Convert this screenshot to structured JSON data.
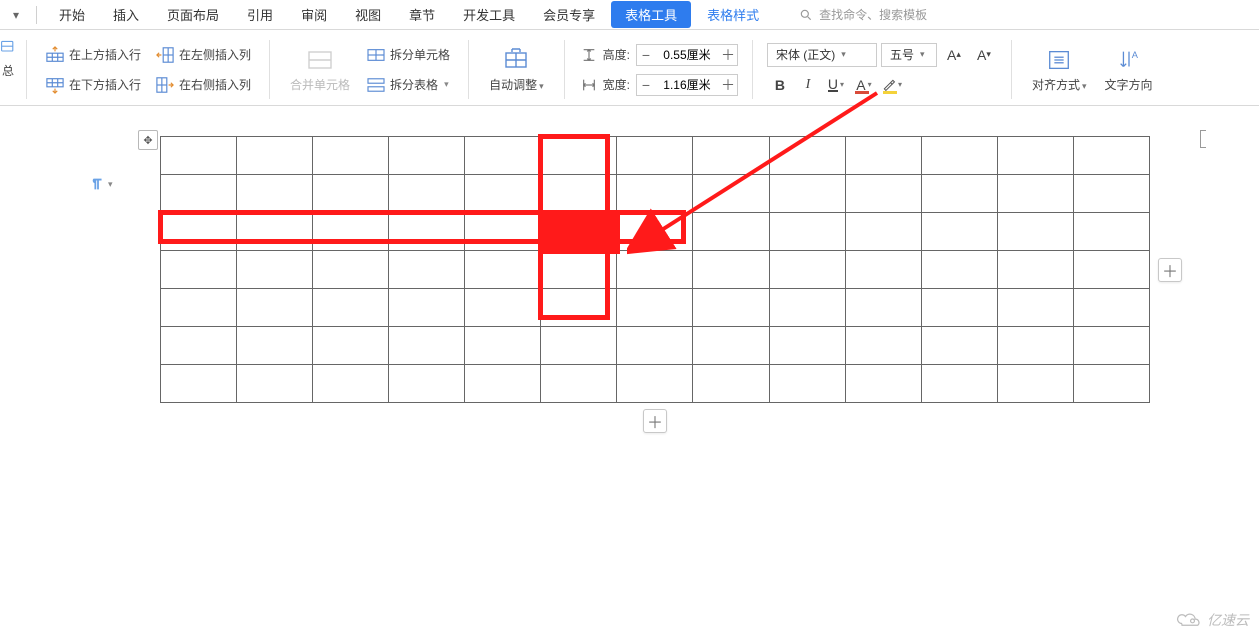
{
  "menu": {
    "items": [
      "开始",
      "插入",
      "页面布局",
      "引用",
      "审阅",
      "视图",
      "章节",
      "开发工具",
      "会员专享"
    ],
    "active_tool": "表格工具",
    "style_tab": "表格样式",
    "search_placeholder": "查找命令、搜索模板"
  },
  "ribbon": {
    "left_trunc_top": "",
    "left_trunc_bottom": "总",
    "insert_row_above": "在上方插入行",
    "insert_row_below": "在下方插入行",
    "insert_col_left": "在左侧插入列",
    "insert_col_right": "在右侧插入列",
    "merge_cells": "合并单元格",
    "split_cells": "拆分单元格",
    "split_table": "拆分表格",
    "auto_fit": "自动调整",
    "height_label": "高度:",
    "width_label": "宽度:",
    "height_value": "0.55厘米",
    "width_value": "1.16厘米",
    "font_name": "宋体 (正文)",
    "font_size": "五号",
    "bold": "B",
    "italic": "I",
    "underline": "U",
    "font_color_letter": "A",
    "align_label": "对齐方式",
    "text_dir_label": "文字方向"
  },
  "table": {
    "rows": 7,
    "cols": 13,
    "highlight": {
      "row_index": 2,
      "col_index": 5,
      "row_span_cols": [
        0,
        6
      ],
      "col_span_rows": [
        0,
        4
      ]
    }
  },
  "watermark": "亿速云",
  "icons": {
    "plus": "＋",
    "minus": "−",
    "caret": "▾",
    "move": "✥"
  }
}
